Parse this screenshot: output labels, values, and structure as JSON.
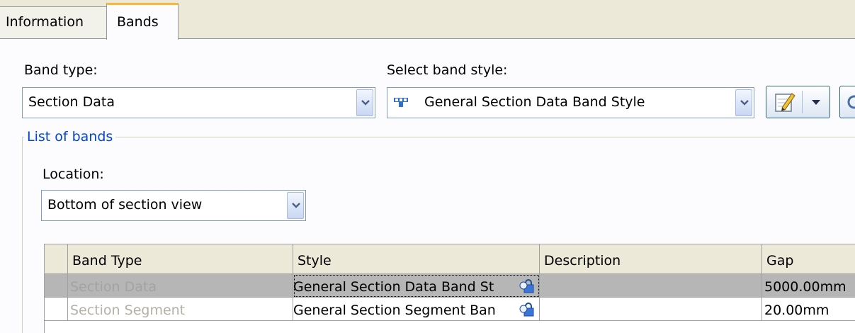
{
  "tabs": [
    {
      "label": "Information"
    },
    {
      "label": "Bands"
    }
  ],
  "band_type": {
    "label": "Band type:",
    "value": "Section Data"
  },
  "band_style": {
    "label": "Select band style:",
    "value": "General Section Data Band Style"
  },
  "list_of_bands": {
    "title": "List of bands",
    "location_label": "Location:",
    "location_value": "Bottom of section view"
  },
  "grid": {
    "columns": [
      "Band Type",
      "Style",
      "Description",
      "Gap"
    ],
    "rows": [
      {
        "band_type": "Section Data",
        "style": "General Section Data Band St",
        "description": "",
        "gap": "5000.00mm"
      },
      {
        "band_type": "Section Segment",
        "style": "General Section Segment Ban",
        "description": "",
        "gap": "20.00mm"
      }
    ]
  },
  "colors": {
    "accent_tab": "#f5b73c",
    "group_title": "#0046d5",
    "selected_row": "#b6b6b6"
  }
}
